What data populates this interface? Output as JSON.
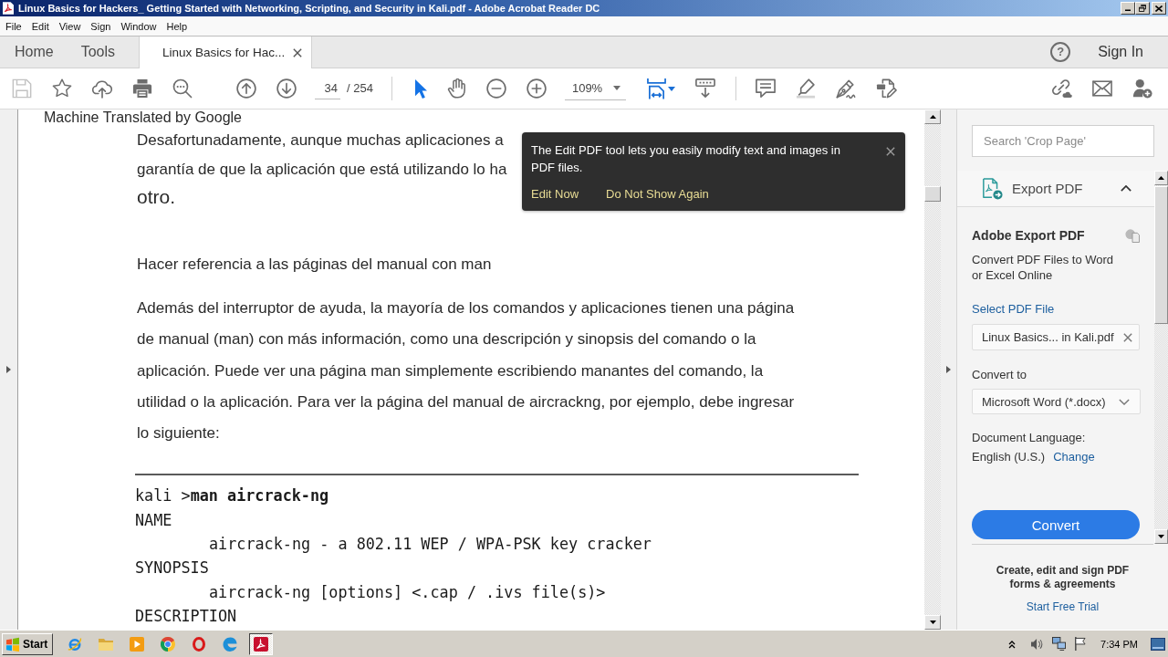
{
  "window": {
    "title": "Linux Basics for Hackers_ Getting Started with Networking, Scripting, and Security in Kali.pdf - Adobe Acrobat Reader DC"
  },
  "menu": [
    "File",
    "Edit",
    "View",
    "Sign",
    "Window",
    "Help"
  ],
  "tabs": [
    {
      "label": "Home",
      "kind": "nav",
      "selected": false
    },
    {
      "label": "Tools",
      "kind": "nav",
      "selected": false
    },
    {
      "label": "Linux Basics for Hac...",
      "kind": "document",
      "selected": true
    }
  ],
  "header": {
    "help": "?",
    "sign_in": "Sign In"
  },
  "toolbar": {
    "page_number": "34",
    "page_total": "/ 254",
    "zoom": "109%",
    "tools": [
      {
        "kind": "select",
        "selected": true
      },
      {
        "kind": "hand",
        "selected": false
      }
    ]
  },
  "tooltip": {
    "text": "The Edit PDF tool lets you easily modify text and images in PDF files.",
    "actions": [
      "Edit Now",
      "Do Not Show Again"
    ]
  },
  "document": {
    "note": "Machine Translated by Google",
    "blocks": [
      {
        "kind": "paragraph",
        "lines": [
          "Desafortunadamente, aunque muchas aplicaciones a",
          "garantía de que la aplicación que está utilizando lo ha",
          "otro."
        ]
      },
      {
        "kind": "heading",
        "text": "Hacer referencia a las páginas del manual con man"
      },
      {
        "kind": "paragraph",
        "lines": [
          "Además del interruptor de ayuda, la mayoría de los comandos y aplicaciones tienen una página",
          "de manual (man) con más información, como una descripción y sinopsis del comando o la",
          "aplicación. Puede ver una página man simplemente escribiendo manantes del comando, la",
          "utilidad o la aplicación. Para ver la página del manual de aircrackng, por ejemplo, debe ingresar",
          "lo siguiente:"
        ]
      },
      {
        "kind": "rule"
      },
      {
        "kind": "code",
        "lines": [
          {
            "text": "kali >**man aircrack-ng**"
          },
          {
            "text": "NAME",
            "children": [
              {
                "text": "aircrack-ng - a 802.11 WEP / WPA-PSK key cracker"
              }
            ]
          },
          {
            "text": "SYNOPSIS",
            "children": [
              {
                "text": "aircrack-ng [options] <.cap / .ivs file(s)>"
              }
            ]
          },
          {
            "text": "DESCRIPTION"
          }
        ]
      }
    ]
  },
  "right_panel": {
    "search": {
      "placeholder": "Search 'Crop Page'"
    },
    "tool": {
      "label": "Export PDF",
      "expanded": true
    },
    "export": {
      "title": "Adobe Export PDF",
      "description": "Convert PDF Files to Word or Excel Online",
      "select_label": "Select PDF File",
      "file": "Linux Basics... in Kali.pdf",
      "convert_to_label": "Convert to",
      "format": "Microsoft Word (*.docx)",
      "language_label": "Document Language:",
      "language": "English (U.S.)",
      "change_link": "Change",
      "button": "Convert"
    },
    "promo": {
      "text": "Create, edit and sign PDF forms & agreements",
      "link": "Start Free Trial"
    }
  },
  "taskbar": {
    "start": "Start",
    "apps": [
      {
        "kind": "e",
        "selected": false
      },
      {
        "kind": "folder",
        "selected": false
      },
      {
        "kind": "player",
        "selected": false
      },
      {
        "kind": "wheel",
        "selected": false
      },
      {
        "kind": "ring",
        "selected": false
      },
      {
        "kind": "wave",
        "selected": false
      },
      {
        "kind": "pdf",
        "selected": true
      }
    ],
    "clock": "7:34 PM"
  }
}
